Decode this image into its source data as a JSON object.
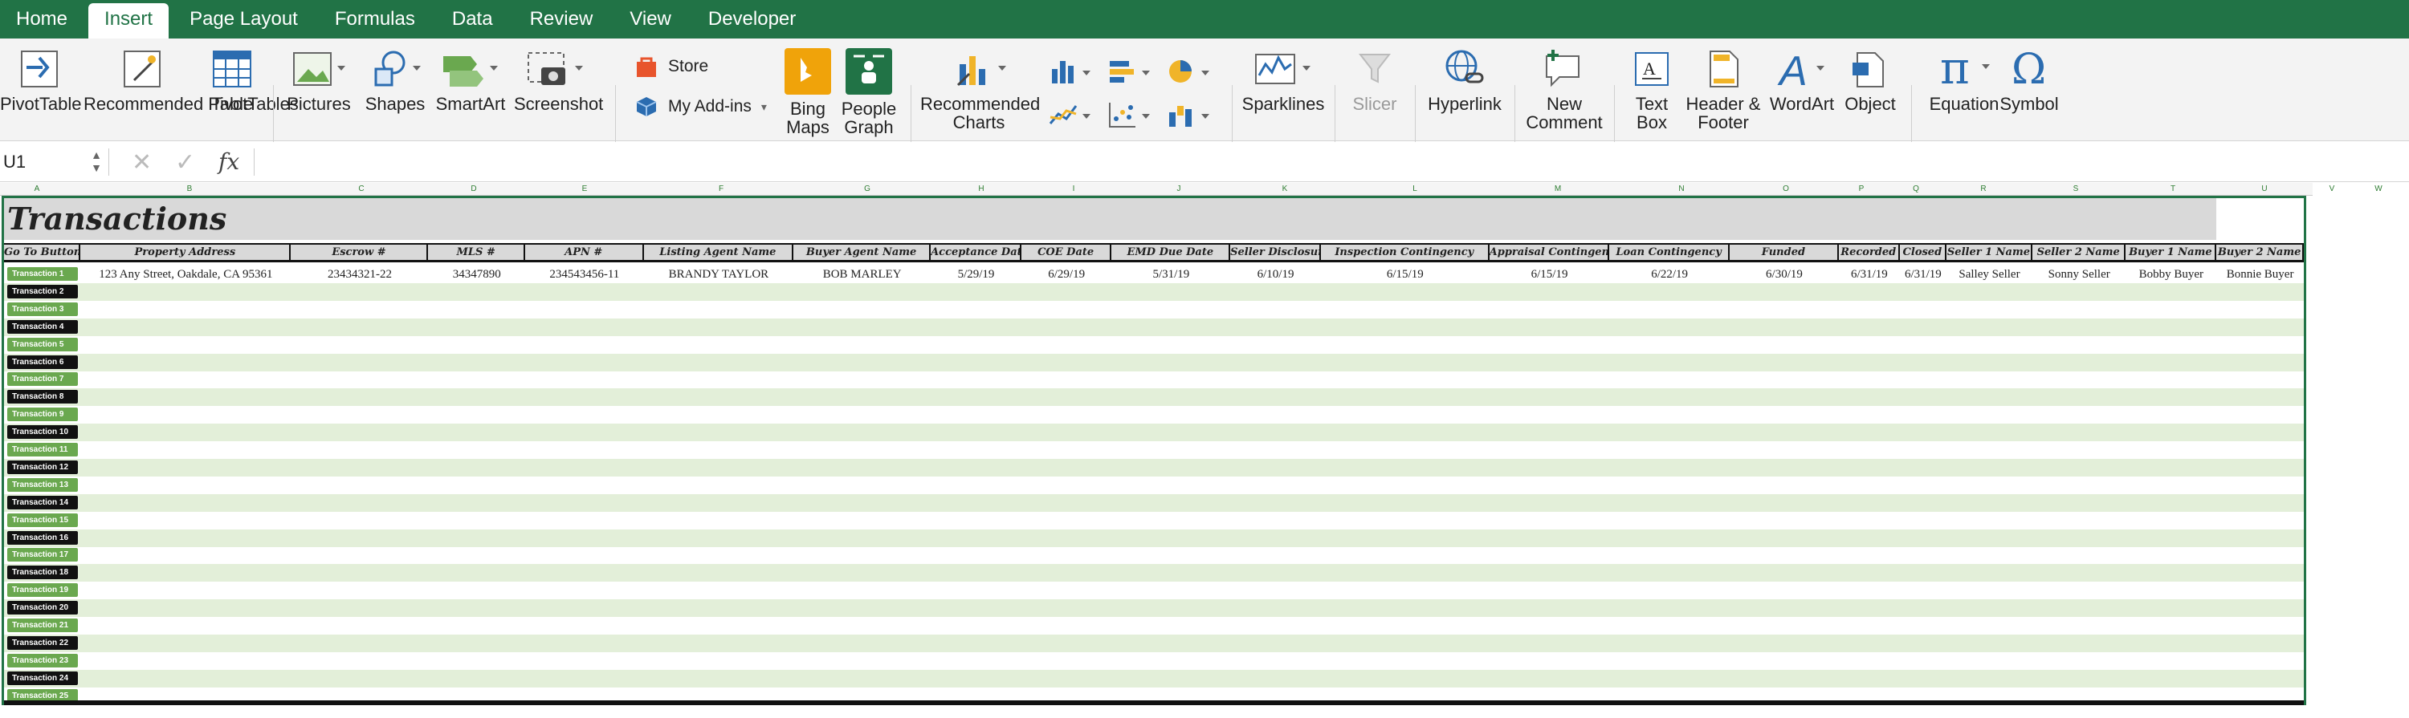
{
  "tabs": [
    "Home",
    "Insert",
    "Page Layout",
    "Formulas",
    "Data",
    "Review",
    "View",
    "Developer"
  ],
  "ribbon": {
    "pivot": "PivotTable",
    "recommended_pivot": "Recommended PivotTables",
    "table": "Table",
    "pictures": "Pictures",
    "shapes": "Shapes",
    "smartart": "SmartArt",
    "screenshot": "Screenshot",
    "store": "Store",
    "addins": "My Add-ins",
    "bing": "Bing Maps",
    "people": "People Graph",
    "rec_charts": "Recommended Charts",
    "sparklines": "Sparklines",
    "slicer": "Slicer",
    "hyperlink": "Hyperlink",
    "comment": "New Comment",
    "textbox": "Text Box",
    "headerfooter": "Header & Footer",
    "wordart": "WordArt",
    "object": "Object",
    "equation": "Equation",
    "symbol": "Symbol"
  },
  "formula_bar": {
    "name_box": "U1",
    "fx": "fx",
    "value": ""
  },
  "col_letters": [
    "A",
    "B",
    "C",
    "D",
    "E",
    "F",
    "G",
    "H",
    "I",
    "J",
    "K",
    "L",
    "M",
    "N",
    "O",
    "P",
    "Q",
    "R",
    "S",
    "T",
    "U",
    "V",
    "W"
  ],
  "sheet": {
    "title": "Transactions",
    "headers": [
      "Go To Button",
      "Property Address",
      "Escrow #",
      "MLS #",
      "APN #",
      "Listing Agent Name",
      "Buyer Agent Name",
      "Acceptance Date",
      "COE Date",
      "EMD Due Date",
      "Seller Disclosures",
      "Inspection Contingency",
      "Appraisal Contingency",
      "Loan Contingency",
      "Funded",
      "Recorded",
      "Closed",
      "Seller 1 Name",
      "Seller 2 Name",
      "Buyer 1 Name",
      "Buyer 2 Name"
    ],
    "row1": [
      "123 Any Street, Oakdale, CA 95361",
      "23434321-22",
      "34347890",
      "234543456-11",
      "BRANDY TAYLOR",
      "BOB MARLEY",
      "5/29/19",
      "6/29/19",
      "5/31/19",
      "6/10/19",
      "6/15/19",
      "6/15/19",
      "6/22/19",
      "6/30/19",
      "6/31/19",
      "6/31/19",
      "Salley Seller",
      "Sonny Seller",
      "Bobby Buyer",
      "Bonnie Buyer"
    ],
    "buttons": [
      "Transaction 1",
      "Transaction 2",
      "Transaction 3",
      "Transaction 4",
      "Transaction 5",
      "Transaction 6",
      "Transaction 7",
      "Transaction 8",
      "Transaction 9",
      "Transaction 10",
      "Transaction 11",
      "Transaction 12",
      "Transaction 13",
      "Transaction 14",
      "Transaction 15",
      "Transaction 16",
      "Transaction 17",
      "Transaction 18",
      "Transaction 19",
      "Transaction 20",
      "Transaction 21",
      "Transaction 22",
      "Transaction 23",
      "Transaction 24",
      "Transaction 25"
    ]
  }
}
